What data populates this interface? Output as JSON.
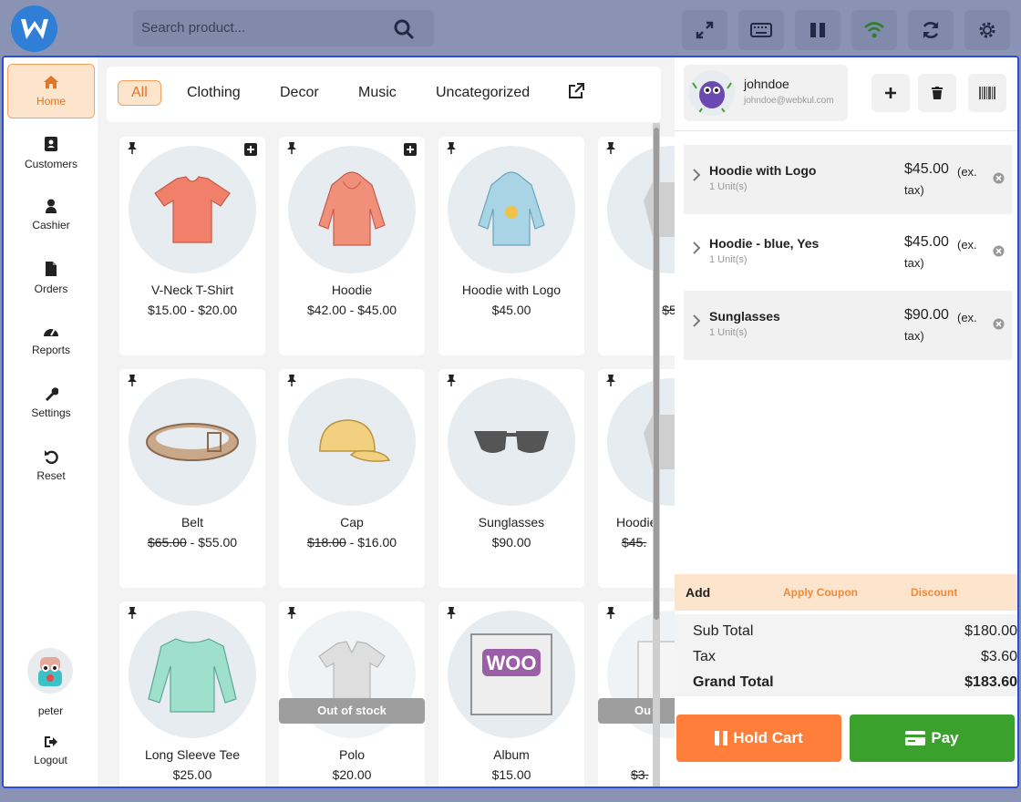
{
  "search": {
    "placeholder": "Search product..."
  },
  "toolbar": {
    "icons": [
      "fullscreen-icon",
      "keyboard-icon",
      "pause-icon",
      "wifi-icon",
      "sync-icon",
      "settings-gear-icon"
    ]
  },
  "sidebar": {
    "items": [
      {
        "label": "Home",
        "icon": "home-icon"
      },
      {
        "label": "Customers",
        "icon": "address-book-icon"
      },
      {
        "label": "Cashier",
        "icon": "user-icon"
      },
      {
        "label": "Orders",
        "icon": "file-icon"
      },
      {
        "label": "Reports",
        "icon": "dashboard-icon"
      },
      {
        "label": "Settings",
        "icon": "wrench-icon"
      },
      {
        "label": "Reset",
        "icon": "undo-icon"
      }
    ],
    "user": "peter",
    "logout": "Logout"
  },
  "categories": [
    "All",
    "Clothing",
    "Decor",
    "Music",
    "Uncategorized"
  ],
  "products": [
    {
      "name": "V-Neck T-Shirt",
      "price": "$15.00 - $20.00"
    },
    {
      "name": "Hoodie",
      "price": "$42.00 - $45.00"
    },
    {
      "name": "Hoodie with Logo",
      "price": "$45.00"
    },
    {
      "name": "",
      "old_price": "$5."
    },
    {
      "name": "Belt",
      "old_price": "$65.00",
      "price": "- $55.00"
    },
    {
      "name": "Cap",
      "old_price": "$18.00",
      "price": "- $16.00"
    },
    {
      "name": "Sunglasses",
      "price": "$90.00"
    },
    {
      "name": "Hoodie",
      "old_price": "$45."
    },
    {
      "name": "Long Sleeve Tee",
      "price": "$25.00"
    },
    {
      "name": "Polo",
      "price": "$20.00",
      "status": "Out of stock"
    },
    {
      "name": "Album",
      "price": "$15.00"
    },
    {
      "name": "",
      "old_price": "$3.",
      "status": "Ou"
    }
  ],
  "customer": {
    "name": "johndoe",
    "email": "johndoe@webkul.com"
  },
  "cart": {
    "lines": [
      {
        "name": "Hoodie with Logo",
        "units": "1 Unit(s)",
        "price": "$45.00",
        "ex": "(ex.",
        "tax": "tax)"
      },
      {
        "name": "Hoodie - blue, Yes",
        "units": "1 Unit(s)",
        "price": "$45.00",
        "ex": "(ex.",
        "tax": "tax)"
      },
      {
        "name": "Sunglasses",
        "units": "1 Unit(s)",
        "price": "$90.00",
        "ex": "(ex.",
        "tax": "tax)"
      }
    ],
    "add": "Add",
    "apply_coupon": "Apply Coupon",
    "discount": "Discount",
    "subtotal_label": "Sub Total",
    "subtotal": "$180.00",
    "tax_label": "Tax",
    "tax": "$3.60",
    "grand_label": "Grand Total",
    "grand": "$183.60",
    "hold": "Hold Cart",
    "pay": "Pay"
  },
  "colors": {
    "accent": "#f08a3c",
    "pay": "#3aa12c",
    "hold": "#ff7f3a",
    "frame": "#2a4fd6"
  }
}
